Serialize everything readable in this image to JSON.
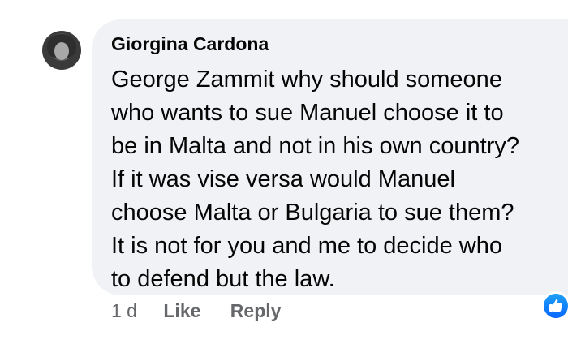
{
  "comment": {
    "author": "Giorgina Cardona",
    "text_lines": [
      "George Zammit why should someone",
      "who wants to sue Manuel choose it to",
      "be in Malta and not in his own country?",
      "If it was vise versa would Manuel",
      "choose Malta or Bulgaria to sue them?",
      "It is not for you and me to decide who",
      "to defend but the law."
    ],
    "timestamp": "1 d",
    "like_label": "Like",
    "reply_label": "Reply",
    "reaction_icon": "like-icon",
    "bubble_color": "#f0f2f5",
    "accent_color": "#0866ff"
  }
}
